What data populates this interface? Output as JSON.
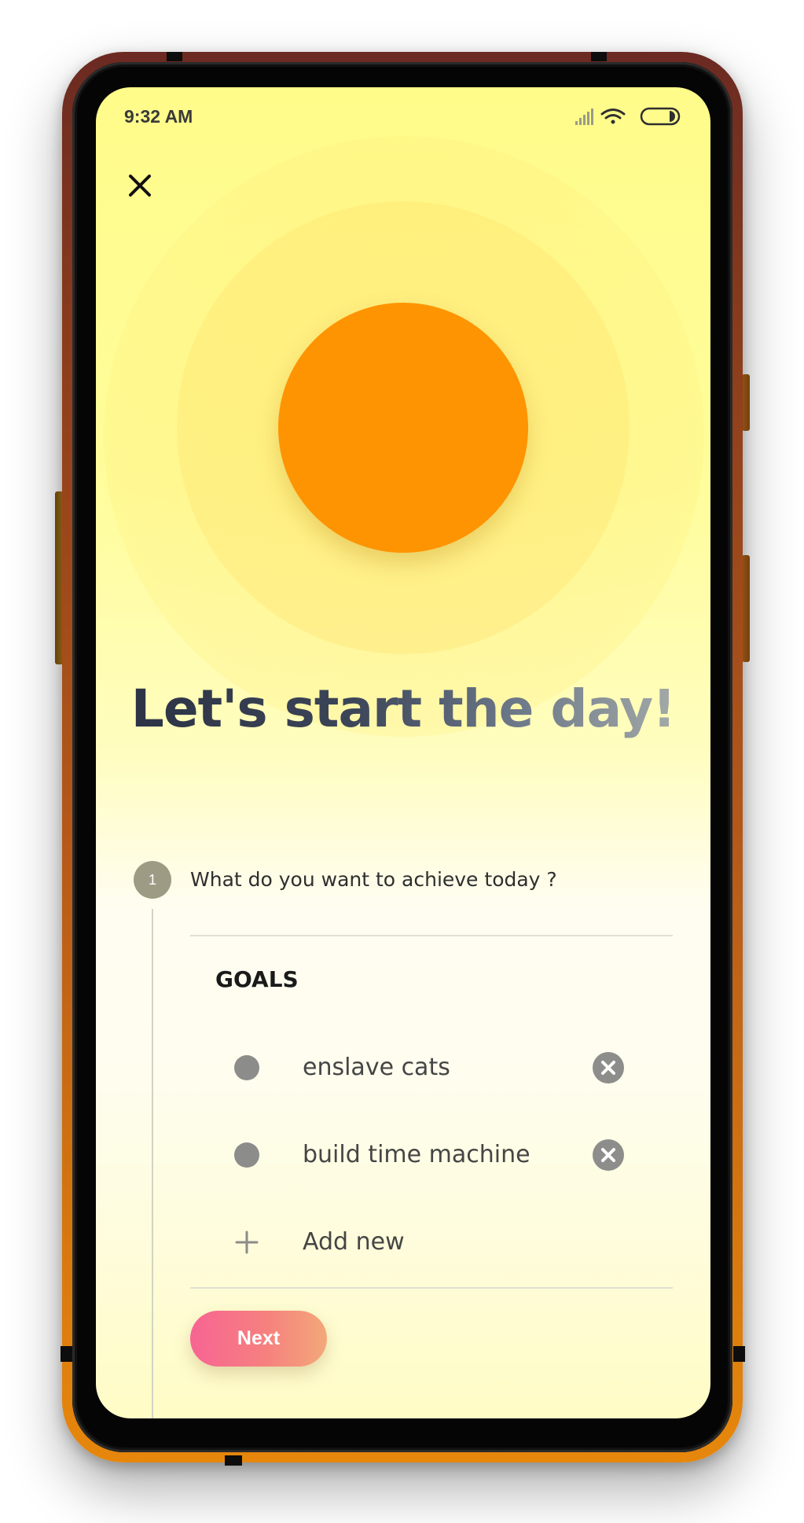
{
  "status_bar": {
    "time": "9:32 AM",
    "icons": [
      "signal-icon",
      "wifi-icon",
      "battery-icon"
    ]
  },
  "header": {
    "close_icon": "close-icon"
  },
  "hero": {
    "headline": "Let's start the day!",
    "sun_color": "#fe9402"
  },
  "step": {
    "number": "1",
    "question": "What do you want to achieve today ?"
  },
  "goals": {
    "title": "GOALS",
    "items": [
      {
        "label": "enslave cats"
      },
      {
        "label": "build time machine"
      }
    ],
    "add_label": "Add new"
  },
  "actions": {
    "next_label": "Next"
  },
  "colors": {
    "accent_start": "#f76493",
    "accent_end": "#f3a879",
    "background_top": "#fffc8a"
  }
}
